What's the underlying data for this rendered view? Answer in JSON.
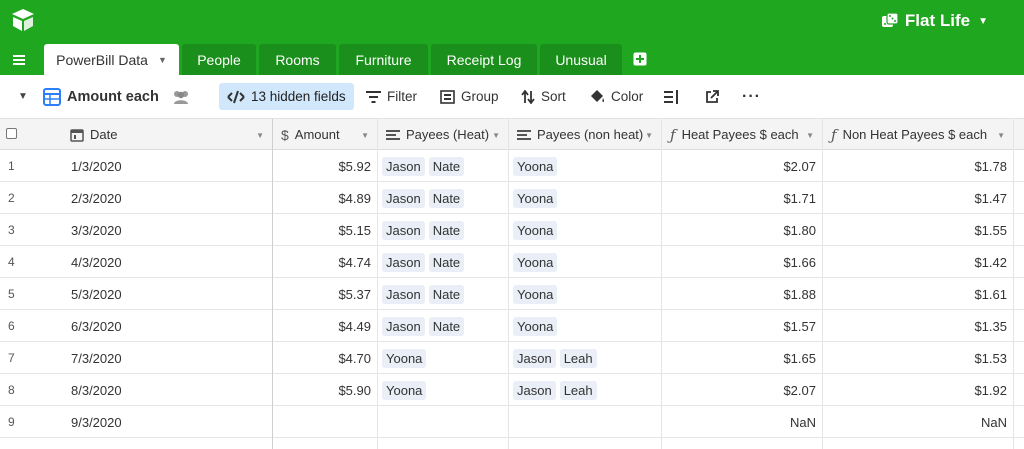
{
  "app": {
    "logo_icon": "airtable-logo-icon",
    "base_name": "Flat Life",
    "base_icon": "dice-icon",
    "accent": "#20a720"
  },
  "tabs": [
    {
      "label": "PowerBill Data",
      "active": true
    },
    {
      "label": "People"
    },
    {
      "label": "Rooms"
    },
    {
      "label": "Furniture"
    },
    {
      "label": "Receipt Log"
    },
    {
      "label": "Unusual"
    }
  ],
  "toolbar": {
    "view_name": "Amount each",
    "hidden_fields": "13 hidden fields",
    "filter": "Filter",
    "group": "Group",
    "sort": "Sort",
    "color": "Color"
  },
  "columns": [
    {
      "label": "Date",
      "icon": "calendar-icon"
    },
    {
      "label": "Amount",
      "icon": "currency-icon"
    },
    {
      "label": "Payees (Heat)",
      "icon": "linked-record-icon"
    },
    {
      "label": "Payees (non heat)",
      "icon": "linked-record-icon"
    },
    {
      "label": "Heat Payees $ each",
      "icon": "formula-icon"
    },
    {
      "label": "Non Heat Payees $ each",
      "icon": "formula-icon"
    }
  ],
  "rows": [
    {
      "n": "1",
      "date": "1/3/2020",
      "amount": "$5.92",
      "heat": [
        "Jason",
        "Nate"
      ],
      "nonheat": [
        "Yoona"
      ],
      "heat_each": "$2.07",
      "nonheat_each": "$1.78"
    },
    {
      "n": "2",
      "date": "2/3/2020",
      "amount": "$4.89",
      "heat": [
        "Jason",
        "Nate"
      ],
      "nonheat": [
        "Yoona"
      ],
      "heat_each": "$1.71",
      "nonheat_each": "$1.47"
    },
    {
      "n": "3",
      "date": "3/3/2020",
      "amount": "$5.15",
      "heat": [
        "Jason",
        "Nate"
      ],
      "nonheat": [
        "Yoona"
      ],
      "heat_each": "$1.80",
      "nonheat_each": "$1.55"
    },
    {
      "n": "4",
      "date": "4/3/2020",
      "amount": "$4.74",
      "heat": [
        "Jason",
        "Nate"
      ],
      "nonheat": [
        "Yoona"
      ],
      "heat_each": "$1.66",
      "nonheat_each": "$1.42"
    },
    {
      "n": "5",
      "date": "5/3/2020",
      "amount": "$5.37",
      "heat": [
        "Jason",
        "Nate"
      ],
      "nonheat": [
        "Yoona"
      ],
      "heat_each": "$1.88",
      "nonheat_each": "$1.61"
    },
    {
      "n": "6",
      "date": "6/3/2020",
      "amount": "$4.49",
      "heat": [
        "Jason",
        "Nate"
      ],
      "nonheat": [
        "Yoona"
      ],
      "heat_each": "$1.57",
      "nonheat_each": "$1.35"
    },
    {
      "n": "7",
      "date": "7/3/2020",
      "amount": "$4.70",
      "heat": [
        "Yoona"
      ],
      "nonheat": [
        "Jason",
        "Leah"
      ],
      "heat_each": "$1.65",
      "nonheat_each": "$1.53"
    },
    {
      "n": "8",
      "date": "8/3/2020",
      "amount": "$5.90",
      "heat": [
        "Yoona"
      ],
      "nonheat": [
        "Jason",
        "Leah"
      ],
      "heat_each": "$2.07",
      "nonheat_each": "$1.92"
    },
    {
      "n": "9",
      "date": "9/3/2020",
      "amount": "",
      "heat": [],
      "nonheat": [],
      "heat_each": "NaN",
      "nonheat_each": "NaN"
    }
  ]
}
